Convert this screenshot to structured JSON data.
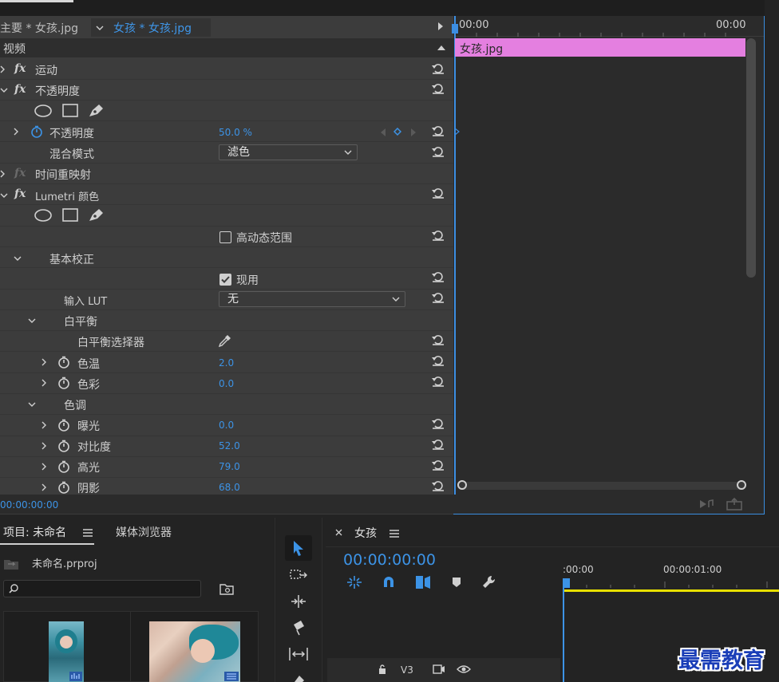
{
  "tabs": {
    "main": "主要 * 女孩.jpg",
    "clip": "女孩 * 女孩.jpg"
  },
  "timecodes": {
    "ruler_start": "00:00",
    "ruler_end": "00:00",
    "bottom": "00:00:00:00"
  },
  "clip_name": "女孩.jpg",
  "section_video": "视频",
  "effects": {
    "motion": "运动",
    "opacity": "不透明度",
    "opacity_param": "不透明度",
    "opacity_value": "50.0 %",
    "blend_mode": "混合模式",
    "blend_value": "滤色",
    "time_remap": "时间重映射",
    "lumetri": "Lumetri 颜色",
    "hdr": "高动态范围",
    "basic": "基本校正",
    "enable": "现用",
    "input_lut": "输入 LUT",
    "input_lut_value": "无",
    "white_balance": "白平衡",
    "wb_selector": "白平衡选择器",
    "temperature": "色温",
    "temperature_value": "2.0",
    "tint": "色彩",
    "tint_value": "0.0",
    "tone": "色调",
    "exposure": "曝光",
    "exposure_value": "0.0",
    "contrast": "对比度",
    "contrast_value": "52.0",
    "highlights": "高光",
    "highlights_value": "79.0",
    "shadows": "阴影",
    "shadows_value": "68.0"
  },
  "project": {
    "tab": "项目: 未命名",
    "media_browser": "媒体浏览器",
    "file": "未命名.prproj"
  },
  "timeline": {
    "title": "女孩",
    "timecode": "00:00:00:00",
    "ruler_a": ":00:00",
    "ruler_b": "00:00:01:00",
    "track": "V3"
  },
  "watermark": "最需教育",
  "colors": {
    "accent": "#2f8ee6",
    "clip": "#e47fe0",
    "work_area": "#e8e000"
  }
}
